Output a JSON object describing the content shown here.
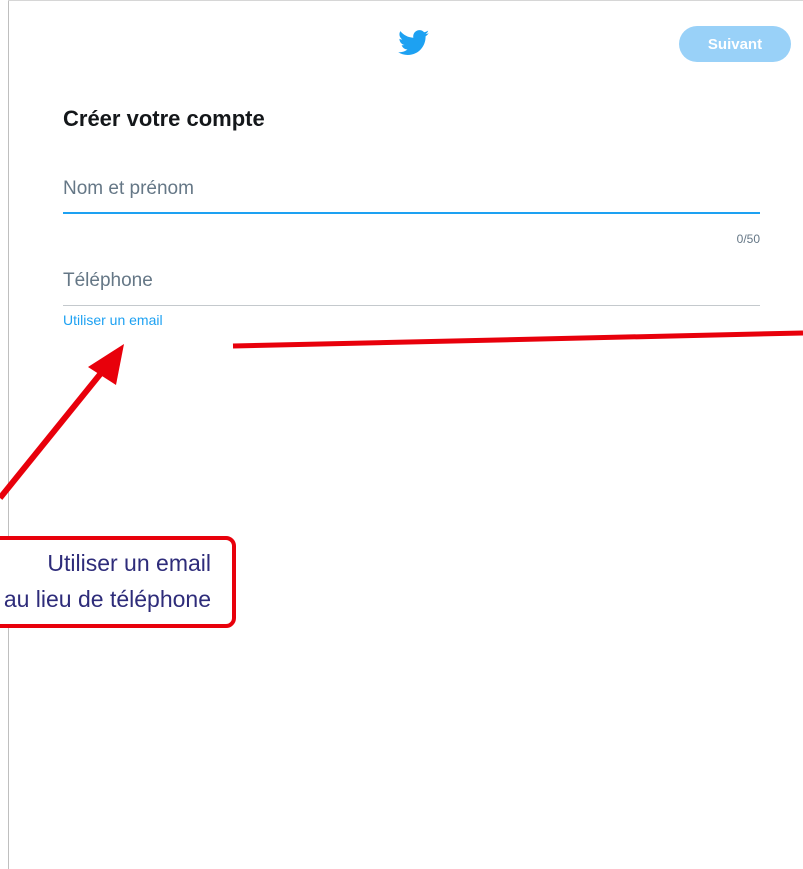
{
  "header": {
    "logo_icon": "twitter-bird-icon",
    "next_button_label": "Suivant"
  },
  "form": {
    "title": "Créer votre compte",
    "name_field": {
      "placeholder": "Nom et prénom",
      "value": "",
      "counter": "0/50"
    },
    "phone_field": {
      "placeholder": "Téléphone",
      "value": ""
    },
    "use_email_link": "Utiliser un email"
  },
  "annotation": {
    "line1": "Utiliser un email",
    "line2": "au lieu de téléphone"
  },
  "colors": {
    "accent": "#1da1f2",
    "button_disabled": "#99d1f8",
    "annotation_red": "#e8000b",
    "annotation_text": "#2e2c7a"
  }
}
